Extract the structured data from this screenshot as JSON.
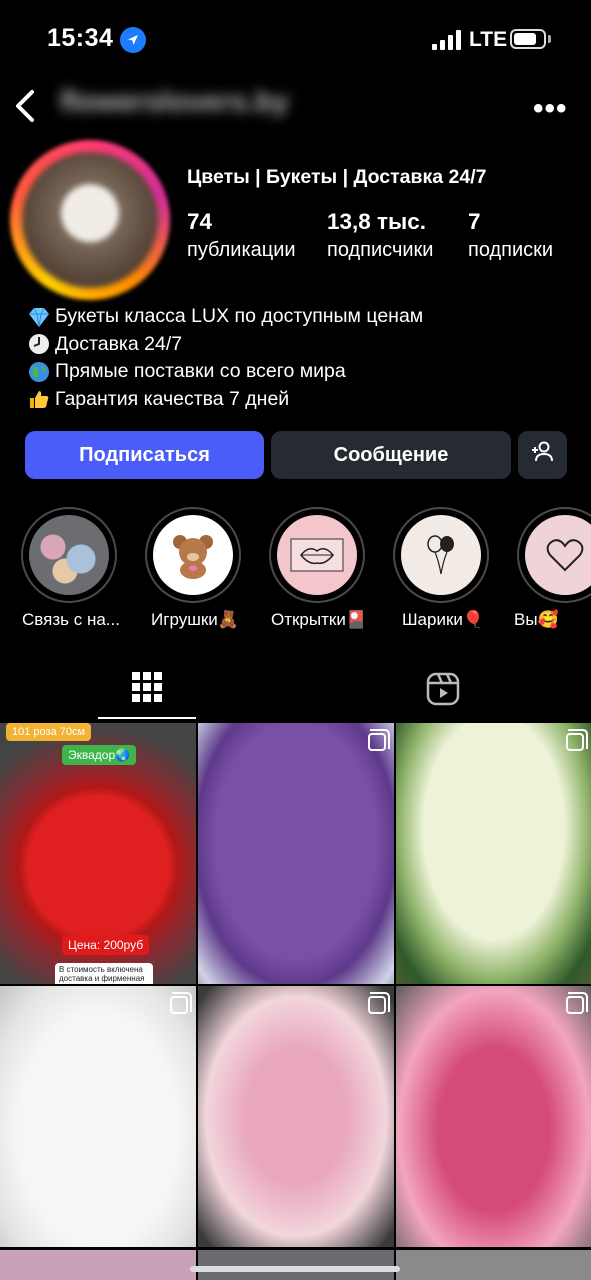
{
  "status_bar": {
    "time": "15:34",
    "network": "LTE"
  },
  "header": {
    "username": "flowerslovers.by"
  },
  "profile": {
    "category": "Цветы | Букеты | Доставка 24/7",
    "stats": [
      {
        "value": "74",
        "label": "публикации"
      },
      {
        "value": "13,8 тыс.",
        "label": "подписчики"
      },
      {
        "value": "7",
        "label": "подписки"
      }
    ],
    "bio": [
      {
        "icon": "gem-icon",
        "text": "Букеты класса LUX по доступным ценам"
      },
      {
        "icon": "clock-icon",
        "text": "Доставка 24/7"
      },
      {
        "icon": "globe-icon",
        "text": "Прямые поставки со всего мира"
      },
      {
        "icon": "thumbs-up-icon",
        "text": "Гарантия качества 7 дней"
      }
    ]
  },
  "actions": {
    "follow": "Подписаться",
    "message": "Сообщение"
  },
  "highlights": [
    {
      "label": "Связь с на..."
    },
    {
      "label": "Игрушки🧸"
    },
    {
      "label": "Открытки🎴"
    },
    {
      "label": "Шарики🎈"
    },
    {
      "label": "Вы🥰"
    }
  ],
  "posts": [
    {
      "tag_top": "101 роза 70см",
      "tag_origin": "Эквадор🌏",
      "price": "Цена: 200руб",
      "note": "В стоимость включена доставка и фирменная упаковка"
    },
    {},
    {},
    {},
    {},
    {}
  ],
  "colors": {
    "follow_button": "#4a5df9",
    "secondary_button": "#262a33",
    "background": "#000000"
  }
}
